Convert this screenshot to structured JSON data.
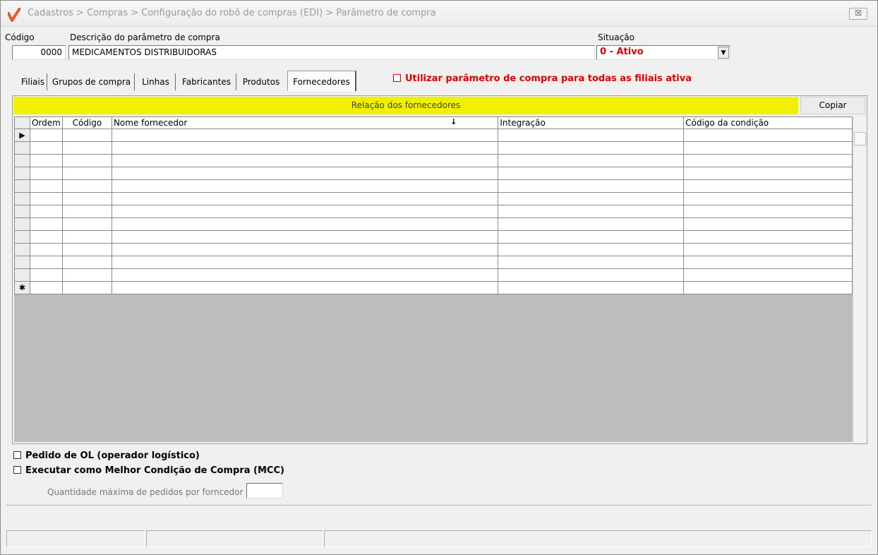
{
  "window": {
    "title": "Cadastros > Compras > Configuração do robô de compras (EDI) > Parâmetro de compra",
    "close_glyph": "☒"
  },
  "form": {
    "codigo_label": "Código",
    "codigo_value": "0000",
    "descricao_label": "Descrição do parâmetro de compra",
    "descricao_value": "MEDICAMENTOS DISTRIBUIDORAS",
    "situacao_label": "Situação",
    "situacao_value": "0 - Ativo"
  },
  "tabs": [
    {
      "label": "Filiais"
    },
    {
      "label": "Grupos de compra"
    },
    {
      "label": "Linhas"
    },
    {
      "label": "Fabricantes"
    },
    {
      "label": "Produtos"
    },
    {
      "label": "Fornecedores",
      "active": true
    }
  ],
  "options": {
    "todas_filiais_label": "Utilizar parâmetro de compra para todas as filiais ativa",
    "pedido_ol_label": "Pedido de OL (operador logístico)",
    "mcc_label": "Executar como Melhor Condição de Compra (MCC)",
    "qtd_max_label": "Quantidade máxima de pedidos por forncedor"
  },
  "fornecedores": {
    "banner": "Relação dos fornecedores",
    "copy_button": "Copiar",
    "columns": [
      "Ordem",
      "Código",
      "Nome fornecedor",
      "Integração",
      "Código da condição"
    ],
    "sort_indicator": "↓",
    "current_row_marker": "▶",
    "new_row_marker": "✱",
    "rows": 13
  },
  "colors": {
    "accent_red": "#e00000",
    "banner_yellow": "#f0f000",
    "logo_orange": "#e8562a"
  }
}
